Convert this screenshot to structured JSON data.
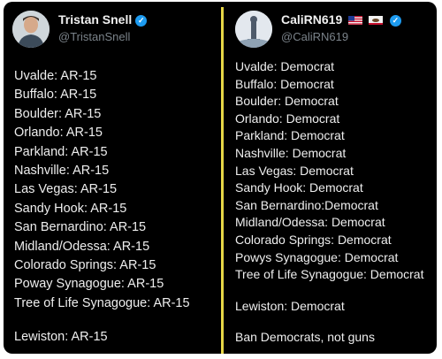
{
  "left_tweet": {
    "display_name": "Tristan Snell",
    "handle": "@TristanSnell",
    "lines_top": [
      "Uvalde: AR-15",
      "Buffalo: AR-15",
      "Boulder: AR-15",
      "Orlando: AR-15",
      "Parkland: AR-15",
      "Nashville: AR-15",
      "Las Vegas: AR-15",
      "Sandy Hook: AR-15",
      "San Bernardino: AR-15",
      "Midland/Odessa: AR-15",
      "Colorado Springs: AR-15",
      "Poway Synagogue: AR-15",
      "Tree of Life Synagogue: AR-15"
    ],
    "lines_bottom": [
      "Lewiston: AR-15"
    ]
  },
  "right_tweet": {
    "display_name": "CaliRN619",
    "handle": "@CaliRN619",
    "lines_top": [
      "Uvalde: Democrat",
      "Buffalo: Democrat",
      "Boulder: Democrat",
      "Orlando: Democrat",
      "Parkland: Democrat",
      "Nashville: Democrat",
      "Las Vegas: Democrat",
      "Sandy Hook: Democrat",
      "San Bernardino:Democrat",
      "Midland/Odessa: Democrat",
      "Colorado Springs: Democrat",
      "Powys Synagogue: Democrat",
      "Tree of Life Synagogue: Democrat"
    ],
    "lines_middle": [
      "Lewiston: Democrat"
    ],
    "lines_bottom": [
      "Ban Democrats, not guns"
    ]
  },
  "icons": {
    "verified": "verified-badge-icon",
    "flags": [
      "us-flag-icon",
      "california-flag-icon"
    ]
  },
  "colors": {
    "background": "#000000",
    "text": "#eeeeee",
    "handle": "#7b838a",
    "divider": "#e7d646",
    "verified": "#1d9bf0"
  }
}
